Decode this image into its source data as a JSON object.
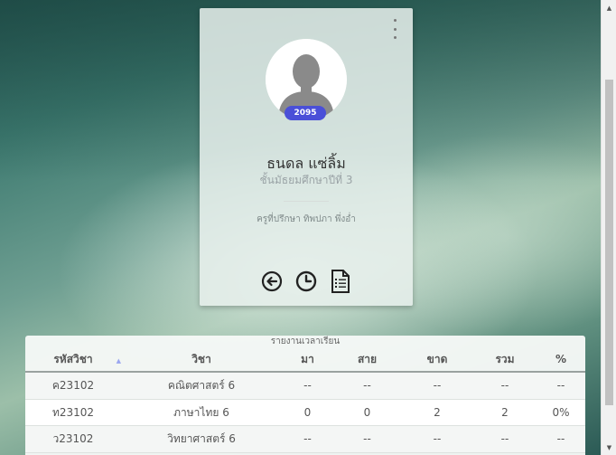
{
  "profile": {
    "student_id_badge": "2095",
    "name": "ธนดล แซ่ลิ้ม",
    "grade": "ชั้นมัธยมศึกษาปีที่ 3",
    "advisor": "ครูที่ปรึกษา ทิพปภา พึ่งอ่ำ",
    "menu_icon": "kebab-menu-icon",
    "avatar_icon": "person-silhouette-icon",
    "actions": [
      {
        "icon": "back-arrow-circle-icon"
      },
      {
        "icon": "clock-icon"
      },
      {
        "icon": "document-list-icon"
      }
    ]
  },
  "report": {
    "title": "รายงานเวลาเรียน",
    "headers": [
      "รหัสวิชา",
      "วิชา",
      "มา",
      "สาย",
      "ขาด",
      "รวม",
      "%"
    ],
    "sort_indicator": "▲",
    "rows": [
      [
        "ค23102",
        "คณิตศาสตร์ 6",
        "--",
        "--",
        "--",
        "--",
        "--"
      ],
      [
        "ท23102",
        "ภาษาไทย 6",
        "0",
        "0",
        "2",
        "2",
        "0%"
      ],
      [
        "ว23102",
        "วิทยาศาสตร์ 6",
        "--",
        "--",
        "--",
        "--",
        "--"
      ]
    ]
  },
  "scrollbar": {
    "up_arrow": "▲",
    "down_arrow": "▼"
  },
  "colors": {
    "badge": "#4a4fd8",
    "card_bg": "#e8f0ec",
    "icon": "#222222"
  }
}
